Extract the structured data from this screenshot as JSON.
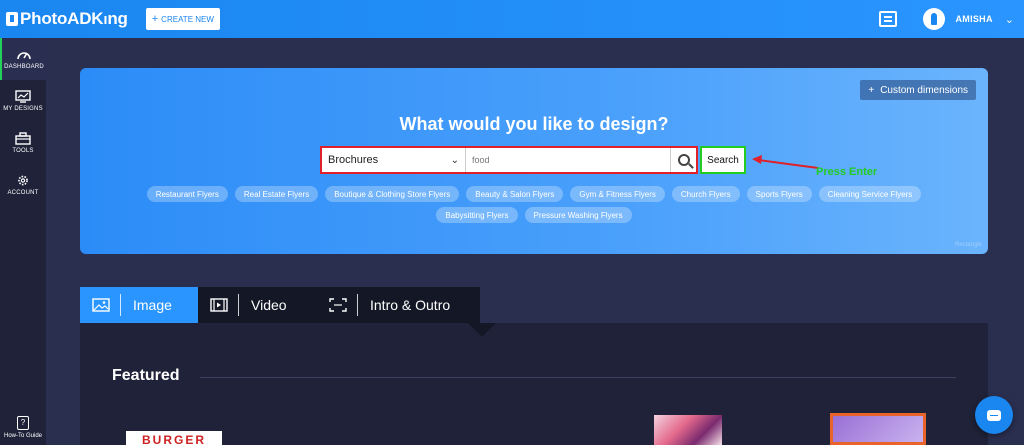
{
  "header": {
    "logo_text": "PhotoADK",
    "logo_text_tail": "ng",
    "create_button_label": "CREATE NEW",
    "create_button_icon": "plus-icon",
    "username": "AMISHA"
  },
  "sidebar": {
    "items": [
      {
        "label": "DASHBOARD",
        "icon": "dashboard-gauge-icon",
        "active": true
      },
      {
        "label": "MY DESIGNS",
        "icon": "monitor-chart-icon",
        "active": false
      },
      {
        "label": "TOOLS",
        "icon": "toolbox-icon",
        "active": false
      },
      {
        "label": "ACCOUNT",
        "icon": "gear-icon",
        "active": false
      }
    ],
    "help_label": "How-To Guide"
  },
  "hero": {
    "custom_dimensions_label": "Custom dimensions",
    "title": "What would you like to design?",
    "category_selected": "Brochures",
    "search_value": "food",
    "search_button_label": "Search",
    "annotation_text": "Press Enter",
    "watermark": "Rectangle",
    "chips": [
      "Restaurant Flyers",
      "Real Estate Flyers",
      "Boutique & Clothing Store Flyers",
      "Beauty & Salon Flyers",
      "Gym & Fitness Flyers",
      "Church Flyers",
      "Sports Flyers",
      "Cleaning Service Flyers",
      "Babysitting Flyers",
      "Pressure Washing Flyers"
    ]
  },
  "tabs": [
    {
      "label": "Image",
      "icon": "image-icon",
      "active": true
    },
    {
      "label": "Video",
      "icon": "film-icon",
      "active": false
    },
    {
      "label": "Intro & Outro",
      "icon": "intro-outro-icon",
      "active": false
    }
  ],
  "content": {
    "section_title": "Featured",
    "thumb_burger_text": "BURGER"
  },
  "colors": {
    "accent": "#1a86f0",
    "highlight_red": "#e0202a",
    "highlight_green": "#22cc22"
  }
}
